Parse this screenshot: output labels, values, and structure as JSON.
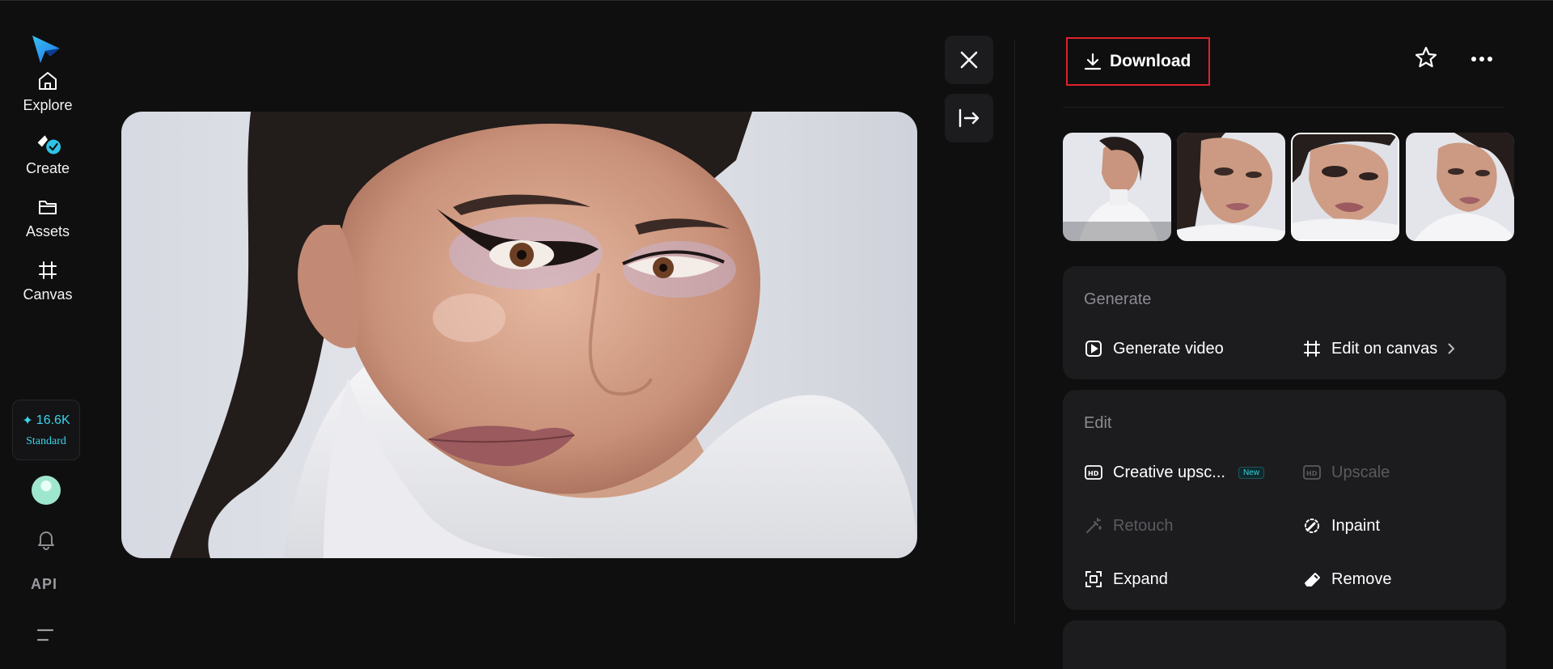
{
  "nav": {
    "items": [
      {
        "label": "Explore"
      },
      {
        "label": "Create"
      },
      {
        "label": "Assets"
      },
      {
        "label": "Canvas"
      }
    ],
    "credits": {
      "amount": "16.6K",
      "plan": "Standard"
    },
    "api_label": "API"
  },
  "toolbar": {
    "download_label": "Download"
  },
  "generate": {
    "title": "Generate",
    "actions": [
      {
        "label": "Generate video"
      },
      {
        "label": "Edit on canvas"
      }
    ]
  },
  "edit": {
    "title": "Edit",
    "new_badge": "New",
    "actions": [
      {
        "label": "Creative upsc..."
      },
      {
        "label": "Upscale"
      },
      {
        "label": "Retouch"
      },
      {
        "label": "Inpaint"
      },
      {
        "label": "Expand"
      },
      {
        "label": "Remove"
      }
    ]
  },
  "colors": {
    "background": "#0f0f10",
    "card": "#1c1c1f",
    "accent": "#37d6ea",
    "highlight_border": "#e0212b",
    "muted_text": "#8b8b90",
    "disabled_text": "#5a5a5f"
  },
  "icons": [
    "logo-icon",
    "home-icon",
    "create-icon",
    "folder-icon",
    "canvas-icon",
    "sparkle-icon",
    "bell-icon",
    "menu-icon",
    "close-icon",
    "collapse-panel-icon",
    "download-icon",
    "star-icon",
    "more-icon",
    "play-icon",
    "crop-icon",
    "chevron-right-icon",
    "hd-plus-icon",
    "hd-icon",
    "wand-icon",
    "inpaint-icon",
    "expand-icon",
    "eraser-icon"
  ]
}
